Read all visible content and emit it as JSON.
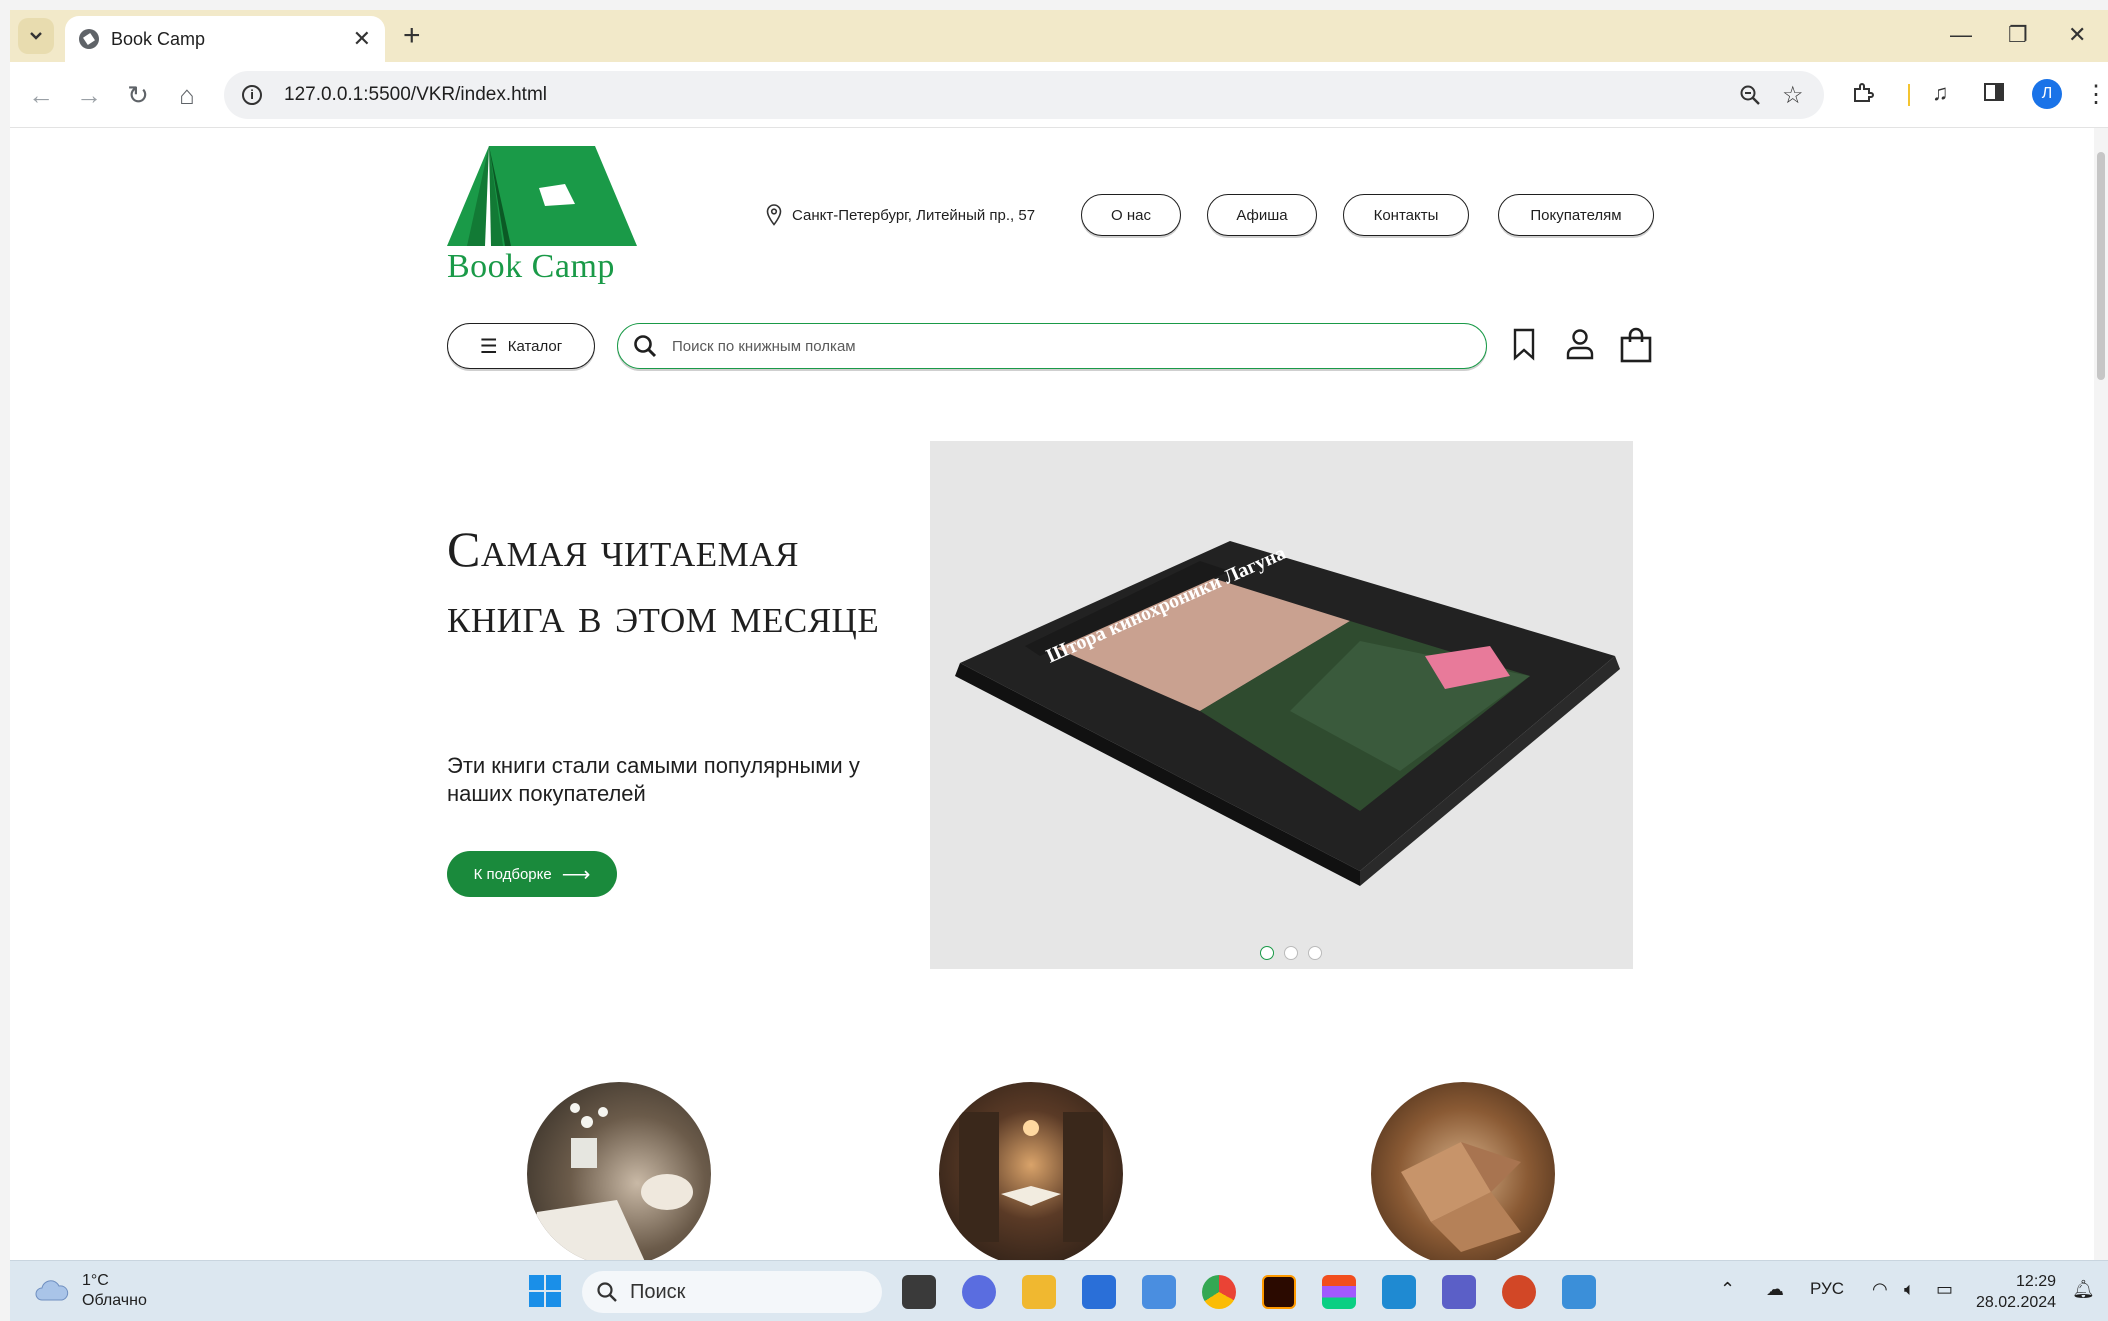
{
  "browser": {
    "tab_title": "Book Camp",
    "url": "127.0.0.1:5500/VKR/index.html",
    "profile_initial": "Л"
  },
  "site": {
    "logo_text": "Book Camp",
    "location": "Санкт-Петербург, Литейный пр., 57",
    "nav": [
      "О нас",
      "Афиша",
      "Контакты",
      "Покупателям"
    ],
    "catalog_label": "Каталог",
    "search_placeholder": "Поиск по книжным полкам",
    "hero": {
      "title": "Самая читаемая книга в этом месяце",
      "subtitle": "Эти книги стали самыми популярными у наших покупателей",
      "button": "К подборке"
    },
    "slider": {
      "book_title": "Штора кинохроники Лагуна",
      "dots": 3,
      "active_dot": 0
    },
    "accent_color": "#1a9a48"
  },
  "taskbar": {
    "weather_temp": "1°C",
    "weather_desc": "Облачно",
    "search_label": "Поиск",
    "language": "РУС",
    "time": "12:29",
    "date": "28.02.2024"
  }
}
